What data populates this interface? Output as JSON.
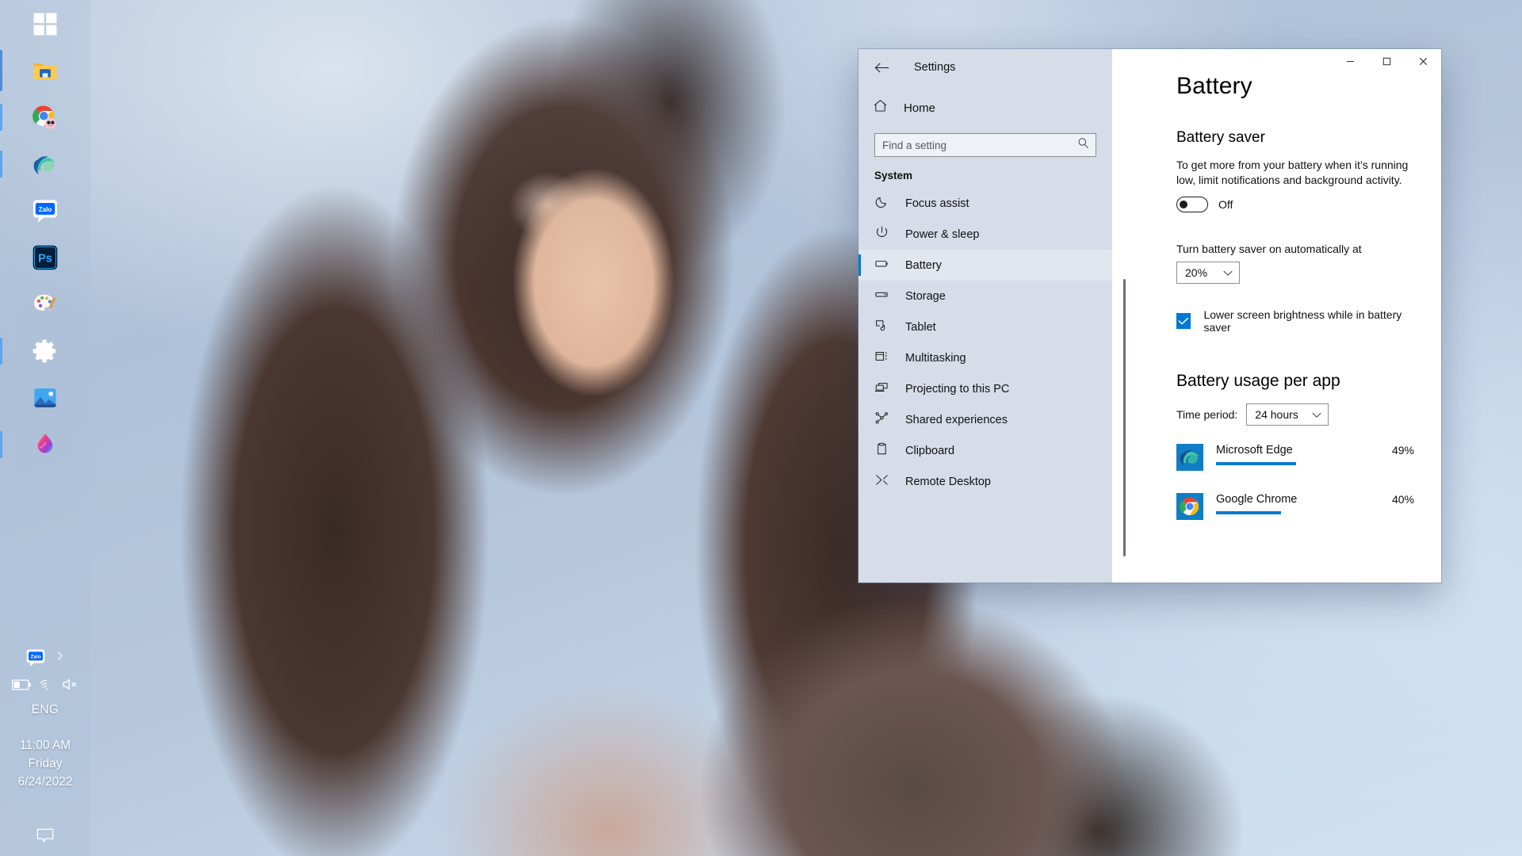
{
  "taskbar": {
    "items": [
      {
        "name": "start",
        "label": "Start",
        "running": false
      },
      {
        "name": "file-explorer",
        "label": "File Explorer",
        "running": true
      },
      {
        "name": "google-chrome",
        "label": "Google Chrome",
        "running": true
      },
      {
        "name": "microsoft-edge",
        "label": "Microsoft Edge",
        "running": true
      },
      {
        "name": "zalo",
        "label": "Zalo",
        "running": false
      },
      {
        "name": "photoshop",
        "label": "Adobe Photoshop",
        "running": false
      },
      {
        "name": "paint",
        "label": "Paint",
        "running": false
      },
      {
        "name": "settings",
        "label": "Settings",
        "running": true
      },
      {
        "name": "photos",
        "label": "Photos",
        "running": false
      },
      {
        "name": "paint-3d",
        "label": "Paint 3D",
        "running": true
      }
    ]
  },
  "tray": {
    "hidden_icons_label": "Show hidden icons",
    "zalo_label": "Zalo",
    "battery_label": "Battery",
    "network_label": "Network",
    "volume_label": "Volume muted",
    "language": "ENG",
    "time": "11:00 AM",
    "day": "Friday",
    "date": "6/24/2022",
    "notifications_label": "Notifications"
  },
  "window": {
    "title": "Settings",
    "back_label": "Back",
    "minimize_label": "Minimize",
    "maximize_label": "Maximize",
    "close_label": "Close"
  },
  "sidebar": {
    "home_label": "Home",
    "search": {
      "placeholder": "Find a setting",
      "value": ""
    },
    "category": "System",
    "items": [
      {
        "label": "Focus assist",
        "icon": "moon-icon",
        "selected": false
      },
      {
        "label": "Power & sleep",
        "icon": "power-icon",
        "selected": false
      },
      {
        "label": "Battery",
        "icon": "battery-icon",
        "selected": true
      },
      {
        "label": "Storage",
        "icon": "storage-icon",
        "selected": false
      },
      {
        "label": "Tablet",
        "icon": "tablet-icon",
        "selected": false
      },
      {
        "label": "Multitasking",
        "icon": "multitasking-icon",
        "selected": false
      },
      {
        "label": "Projecting to this PC",
        "icon": "projecting-icon",
        "selected": false
      },
      {
        "label": "Shared experiences",
        "icon": "shared-experiences-icon",
        "selected": false
      },
      {
        "label": "Clipboard",
        "icon": "clipboard-icon",
        "selected": false
      },
      {
        "label": "Remote Desktop",
        "icon": "remote-desktop-icon",
        "selected": false
      }
    ]
  },
  "content": {
    "page_title": "Battery",
    "battery_saver": {
      "heading": "Battery saver",
      "description": "To get more from your battery when it’s running low, limit notifications and background activity.",
      "toggle_state": "Off",
      "auto_on_label": "Turn battery saver on automatically at",
      "auto_on_value": "20%",
      "lower_brightness_label": "Lower screen brightness while in battery saver",
      "lower_brightness_checked": true
    },
    "usage": {
      "heading": "Battery usage per app",
      "time_period_label": "Time period:",
      "time_period_value": "24 hours",
      "apps": [
        {
          "name": "Microsoft Edge",
          "percent": "49%",
          "value": 49,
          "icon": "edge-icon"
        },
        {
          "name": "Google Chrome",
          "percent": "40%",
          "value": 40,
          "icon": "chrome-icon"
        }
      ]
    }
  },
  "colors": {
    "accent": "#0078d4",
    "bar": "#0a7bd1",
    "sidebar_bg": "#d6dde8"
  }
}
